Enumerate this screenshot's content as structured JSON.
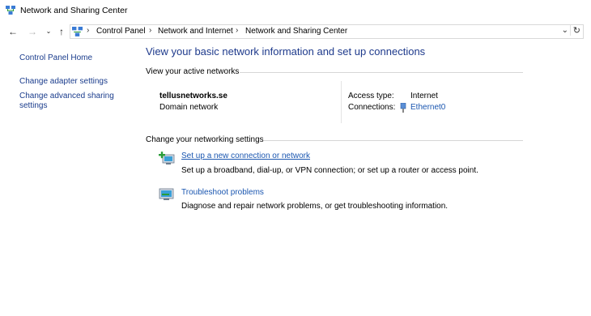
{
  "window": {
    "title": "Network and Sharing Center"
  },
  "address_bar": {
    "crumbs": [
      "Control Panel",
      "Network and Internet",
      "Network and Sharing Center"
    ]
  },
  "sidebar": {
    "items": [
      {
        "label": "Control Panel Home"
      },
      {
        "label": "Change adapter settings"
      },
      {
        "label": "Change advanced sharing settings"
      }
    ]
  },
  "main": {
    "title": "View your basic network information and set up connections",
    "active_networks": {
      "header": "View your active networks",
      "network_name": "tellusnetworks.se",
      "network_type": "Domain network",
      "access_type_label": "Access type:",
      "access_type_value": "Internet",
      "connections_label": "Connections:",
      "connections_value": "Ethernet0"
    },
    "settings": {
      "header": "Change your networking settings",
      "tasks": [
        {
          "link": "Set up a new connection or network",
          "desc": "Set up a broadband, dial-up, or VPN connection; or set up a router or access point.",
          "icon": "new-connection-icon"
        },
        {
          "link": "Troubleshoot problems",
          "desc": "Diagnose and repair network problems, or get troubleshooting information.",
          "icon": "troubleshoot-icon"
        }
      ]
    }
  }
}
